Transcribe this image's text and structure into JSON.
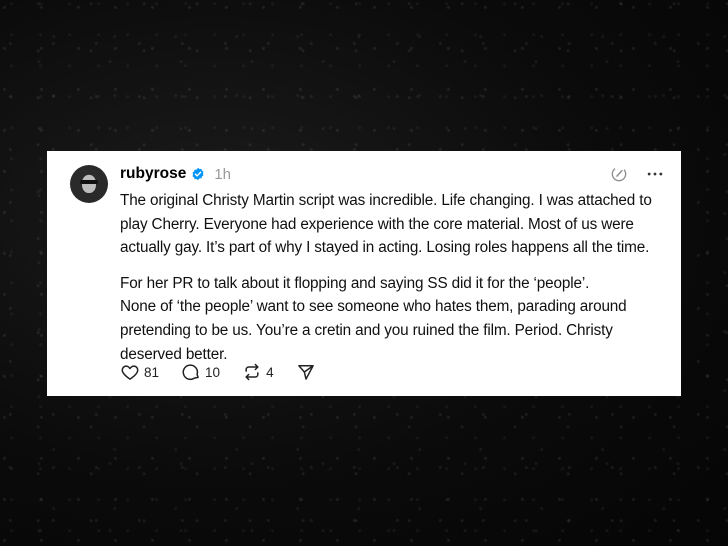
{
  "post": {
    "username": "rubyrose",
    "timestamp": "1h",
    "verified": true,
    "paragraphs": [
      "The original Christy Martin script was incredible. Life changing. I was attached to\nplay Cherry. Everyone had experience with the core material. Most of us were\nactually gay. It’s part of why I stayed in acting. Losing roles happens all the time.",
      "For her PR to talk about it flopping and saying SS did it for the ‘people’.\nNone of ‘the people’ want to see someone who hates them, parading around\npretending to be us. You’re a cretin and you ruined the film. Period. Christy\ndeserved better."
    ],
    "stats": {
      "likes": "81",
      "replies": "10",
      "reposts": "4"
    },
    "icons": {
      "verified": "verified-badge-icon",
      "edit": "edit-indicator-icon",
      "more": "more-options-icon",
      "like": "heart-icon",
      "reply": "comment-icon",
      "repost": "repost-icon",
      "share": "send-icon"
    }
  },
  "colors": {
    "background": "#0d0d0d",
    "card": "#ffffff",
    "text": "#101010",
    "muted": "#9a9a9a",
    "verified_blue": "#0095f6"
  }
}
